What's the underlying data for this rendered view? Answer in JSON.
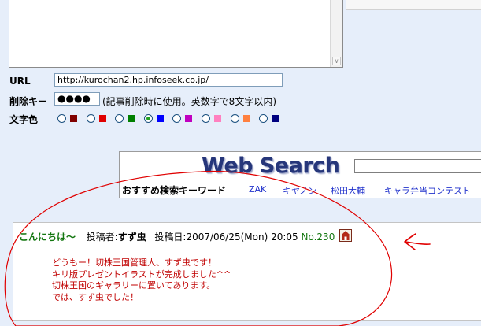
{
  "form": {
    "url_label": "URL",
    "url_value": "http://kurochan2.hp.infoseek.co.jp/",
    "delete_key_label": "削除キー",
    "delete_key_value": "●●●●",
    "delete_key_hint": "(記事削除時に使用。英数字で8文字以内)",
    "text_color_label": "文字色",
    "color_options": [
      {
        "color": "#800000",
        "checked": false
      },
      {
        "color": "#e00000",
        "checked": false
      },
      {
        "color": "#008000",
        "checked": false
      },
      {
        "color": "#0000ff",
        "checked": true
      },
      {
        "color": "#c000c0",
        "checked": false
      },
      {
        "color": "#ff80c0",
        "checked": false
      },
      {
        "color": "#ff8040",
        "checked": false
      },
      {
        "color": "#000080",
        "checked": false
      }
    ]
  },
  "search": {
    "logo": "Web Search",
    "keyword_heading": "おすすめ検索キーワード",
    "keywords": [
      "ZAK",
      "キヤノン",
      "松田大輔",
      "キャラ弁当コンテスト"
    ]
  },
  "post": {
    "greeting": "こんにちは〜",
    "author_label": "投稿者:",
    "author": "すず虫",
    "date_label": "投稿日:",
    "date": "2007/06/25(Mon) 20:05",
    "number": "No.230",
    "body": [
      "どうもー！切株王国管理人、すず虫です！",
      "キリ版プレゼントイラストが完成しました^^",
      "切株王国のギャラリーに置いてあります。",
      "では、すず虫でした！"
    ]
  },
  "icons": {
    "scroll_down": "chevron-down-icon",
    "home": "home-icon"
  },
  "colors": {
    "background": "#e6eefa",
    "annotation": "#e00000",
    "greeting": "#12760f",
    "body_text": "#c00000",
    "link": "#2233cc"
  }
}
